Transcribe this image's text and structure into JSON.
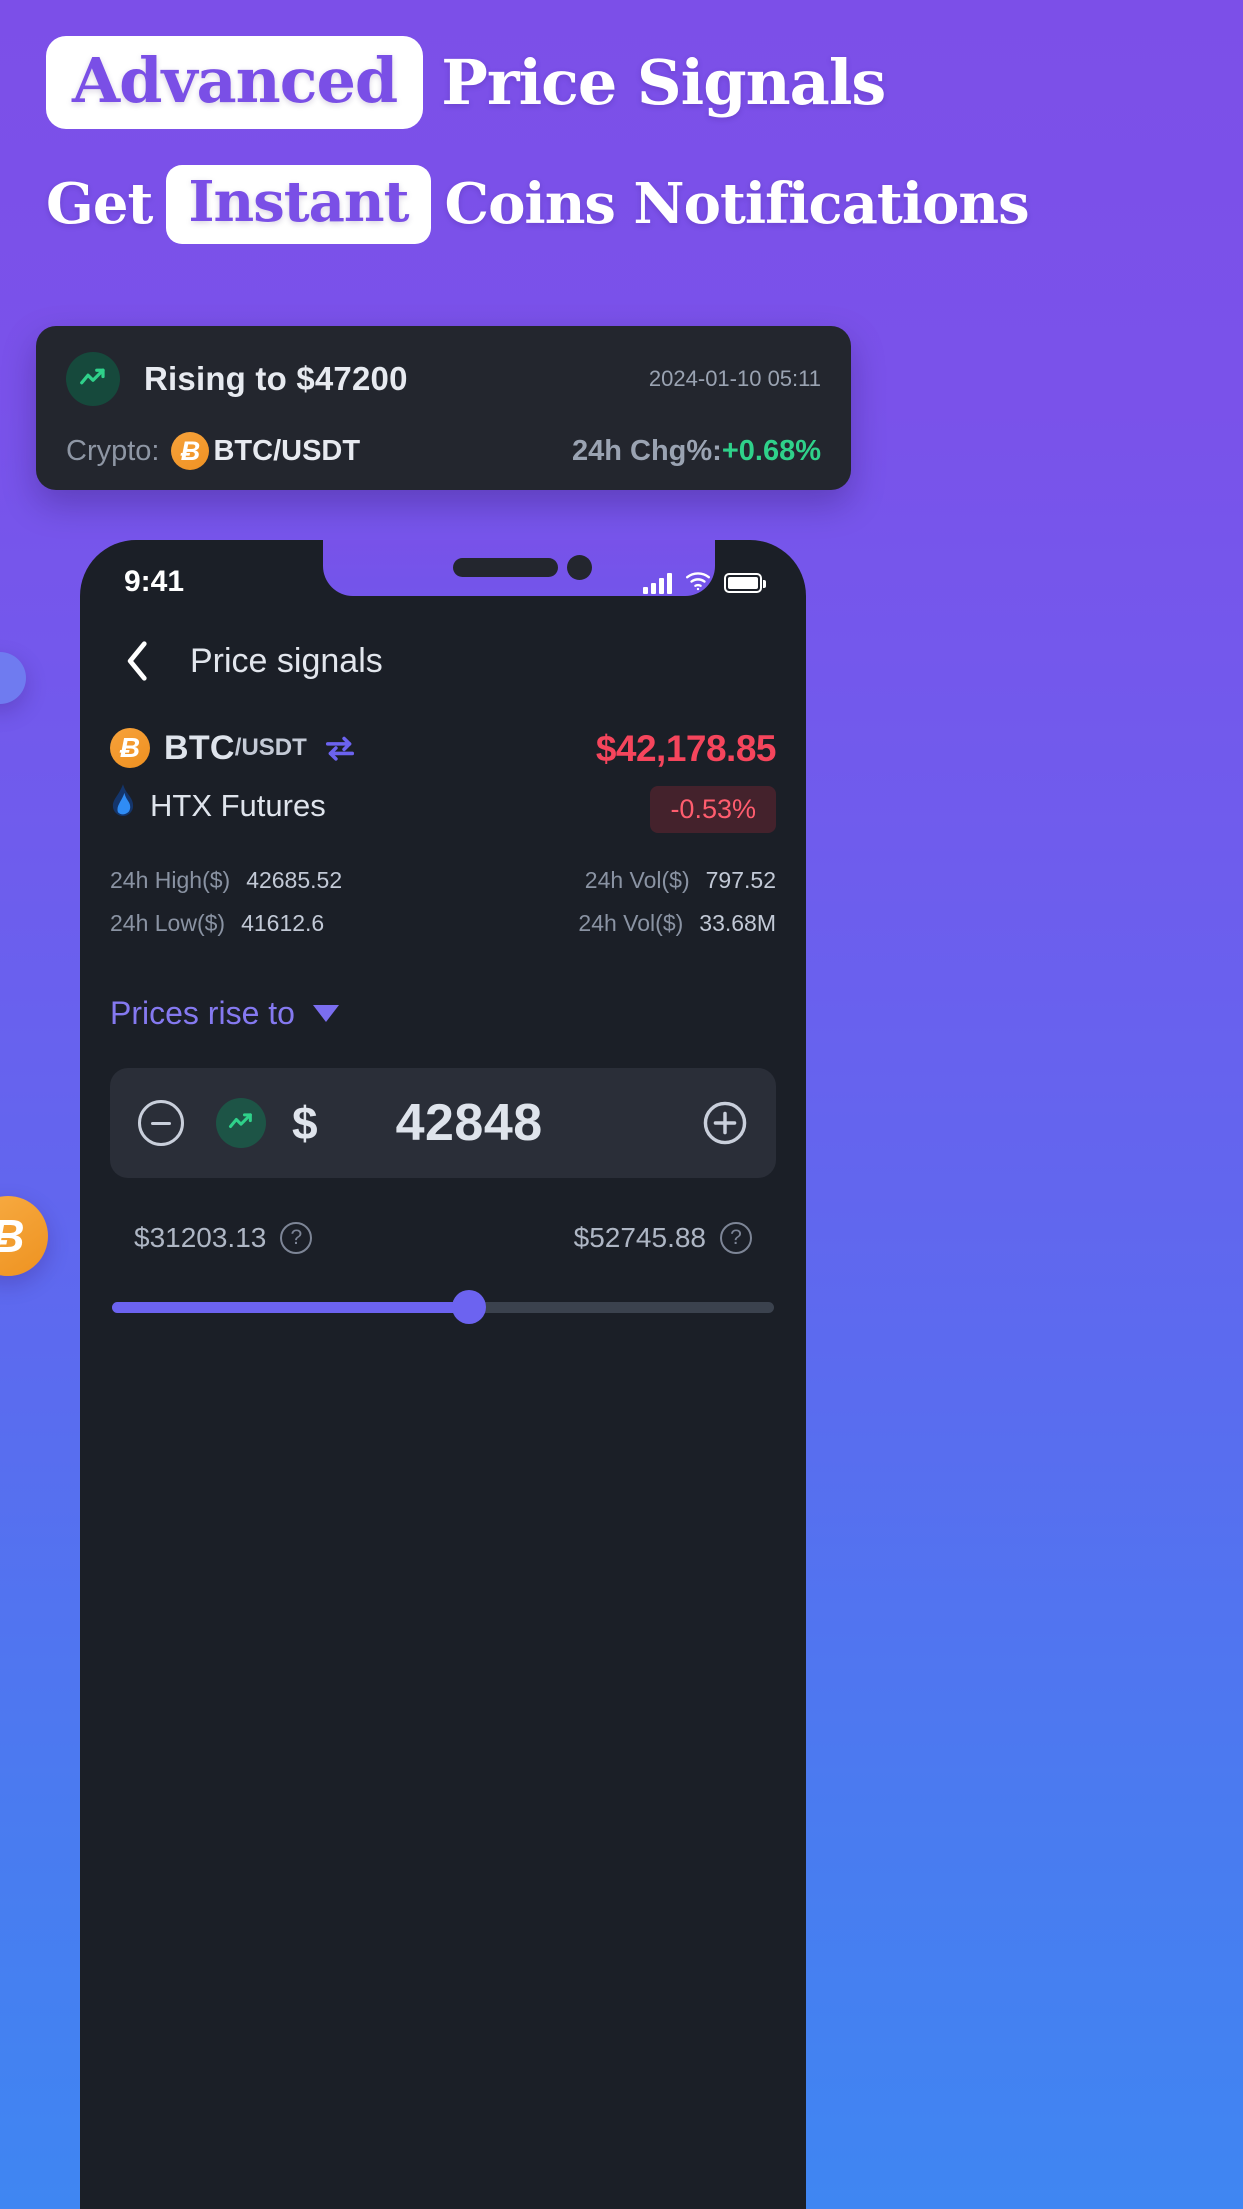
{
  "headline": {
    "line1_chip": "Advanced",
    "line1_rest": "Price Signals",
    "line2_pre": "Get",
    "line2_chip": "Instant",
    "line2_rest": "Coins Notifications"
  },
  "notification": {
    "icon": "trending-up-icon",
    "title": "Rising to $47200",
    "timestamp": "2024-01-10 05:11",
    "crypto_label": "Crypto:",
    "coin_symbol": "Ƀ",
    "pair": "BTC/USDT",
    "chg_label": "24h Chg%:",
    "chg_value": "+0.68%",
    "chg_color": "#2fd18a"
  },
  "phone": {
    "status": {
      "time": "9:41",
      "signal": "cellular-bars-icon",
      "wifi": "wifi-icon",
      "battery": "battery-full-icon"
    },
    "nav": {
      "back": "chevron-left-icon",
      "title": "Price signals"
    },
    "ticker": {
      "coin_symbol": "Ƀ",
      "base": "BTC",
      "quote": "/USDT",
      "swap": "swap-horizontal-icon",
      "venue_logo": "htx-droplet-icon",
      "venue": "HTX Futures",
      "price": "$42,178.85",
      "price_color": "#f5455c",
      "change": "-0.53%",
      "change_bg": "#44222c",
      "change_color": "#ff5d6e"
    },
    "stats": {
      "left": [
        {
          "key": "24h High($)",
          "value": "42685.52"
        },
        {
          "key": "24h Low($)",
          "value": "41612.6"
        }
      ],
      "right": [
        {
          "key": "24h Vol($)",
          "value": "797.52"
        },
        {
          "key": "24h Vol($)",
          "value": "33.68M"
        }
      ]
    },
    "condition": {
      "label": "Prices rise to",
      "caret": "caret-down-icon"
    },
    "stepper": {
      "minus": "minus-circle-icon",
      "trend": "trending-up-icon",
      "currency": "$",
      "value": "42848",
      "plus": "plus-circle-icon"
    },
    "bounds": {
      "min": "$31203.13",
      "max": "$52745.88",
      "help": "?"
    },
    "slider": {
      "percent": 54,
      "fill_color": "#6c63f0",
      "track_color": "#3b424e"
    }
  },
  "decor": {
    "coin_left": "Ƀ",
    "accent": "#7a4fe6"
  }
}
